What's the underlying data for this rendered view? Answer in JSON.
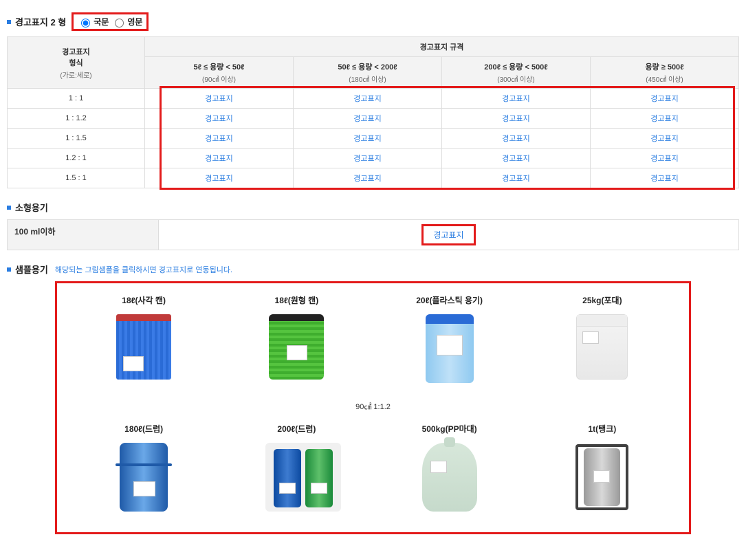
{
  "section1": {
    "title": "경고표지 2 형",
    "radio_kr": "국문",
    "radio_en": "영문"
  },
  "spec_table": {
    "header_left_line1": "경고표지",
    "header_left_line2": "형식",
    "header_left_sub": "(가로:세로)",
    "header_group": "경고표지 규격",
    "columns": [
      {
        "main": "5ℓ ≤ 용량 < 50ℓ",
        "sub": "(90㎠ 이상)"
      },
      {
        "main": "50ℓ ≤ 용량 < 200ℓ",
        "sub": "(180㎠ 이상)"
      },
      {
        "main": "200ℓ ≤ 용량 < 500ℓ",
        "sub": "(300㎠ 이상)"
      },
      {
        "main": "용량 ≥ 500ℓ",
        "sub": "(450㎠ 이상)"
      }
    ],
    "ratios": [
      "1 : 1",
      "1 : 1.2",
      "1 : 1.5",
      "1.2 : 1",
      "1.5 : 1"
    ],
    "link_label": "경고표지"
  },
  "section2": {
    "title": "소형용기",
    "row_label": "100 ml이하",
    "link_label": "경고표지"
  },
  "section3": {
    "title": "샘플용기",
    "helper": "해당되는 그림샘플을 클릭하시면 경고표지로 연동됩니다.",
    "row1": [
      {
        "label": "18ℓ(사각 캔)"
      },
      {
        "label": "18ℓ(원형 캔)"
      },
      {
        "label": "20ℓ(플라스틱 용기)"
      },
      {
        "label": "25kg(포대)"
      }
    ],
    "mid_caption": "90㎠ 1:1.2",
    "row2": [
      {
        "label": "180ℓ(드럼)"
      },
      {
        "label": "200ℓ(드럼)"
      },
      {
        "label": "500kg(PP마대)"
      },
      {
        "label": "1t(탱크)"
      }
    ]
  }
}
